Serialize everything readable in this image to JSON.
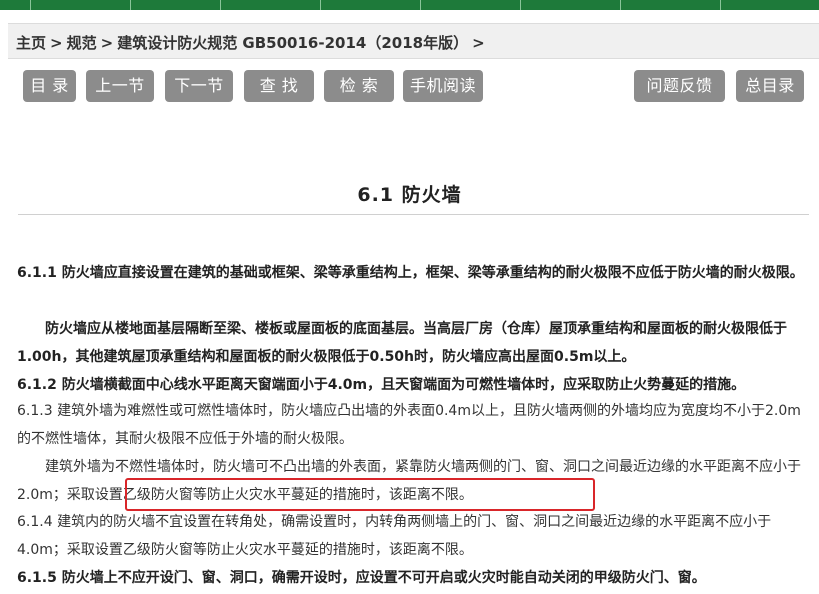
{
  "breadcrumb": {
    "home": "主页",
    "section": "规范",
    "current": "建筑设计防火规范 GB50016-2014（2018年版）",
    "separator": ">"
  },
  "toolbar": {
    "toc": "目 录",
    "prev": "上一节",
    "next": "下一节",
    "find": "查 找",
    "search": "检 索",
    "mobile": "手机阅读",
    "feedback": "问题反馈",
    "master_toc": "总目录"
  },
  "title": "6.1 防火墙",
  "paragraphs": [
    "6.1.1 防火墙应直接设置在建筑的基础或框架、梁等承重结构上，框架、梁等承重结构的耐火极限不应低于防火墙的耐火极限。",
    "防火墙应从楼地面基层隔断至梁、楼板或屋面板的底面基层。当高层厂房（仓库）屋顶承重结构和屋面板的耐火极限低于1.00h，其他建筑屋顶承重结构和屋面板的耐火极限低于0.50h时，防火墙应高出屋面0.5m以上。",
    "6.1.2 防火墙横截面中心线水平距离天窗端面小于4.0m，且天窗端面为可燃性墙体时，应采取防止火势蔓延的措施。",
    "6.1.3 建筑外墙为难燃性或可燃性墙体时，防火墙应凸出墙的外表面0.4m以上，且防火墙两侧的外墙均应为宽度均不小于2.0m的不燃性墙体，其耐火极限不应低于外墙的耐火极限。",
    "建筑外墙为不燃性墙体时，防火墙可不凸出墙的外表面，紧靠防火墙两侧的门、窗、洞口之间最近边缘的水平距离不应小于2.0m；采取设置乙级防火窗等防止火灾水平蔓延的措施时，该距离不限。",
    "6.1.4 建筑内的防火墙不宜设置在转角处，确需设置时，内转角两侧墙上的门、窗、洞口之间最近边缘的水平距离不应小于4.0m；采取设置乙级防火窗等防止火灾水平蔓延的措施时，该距离不限。",
    "6.1.5 防火墙上不应开设门、窗、洞口，确需开设时，应设置不可开启或火灾时能自动关闭的甲级防火门、窗。"
  ]
}
